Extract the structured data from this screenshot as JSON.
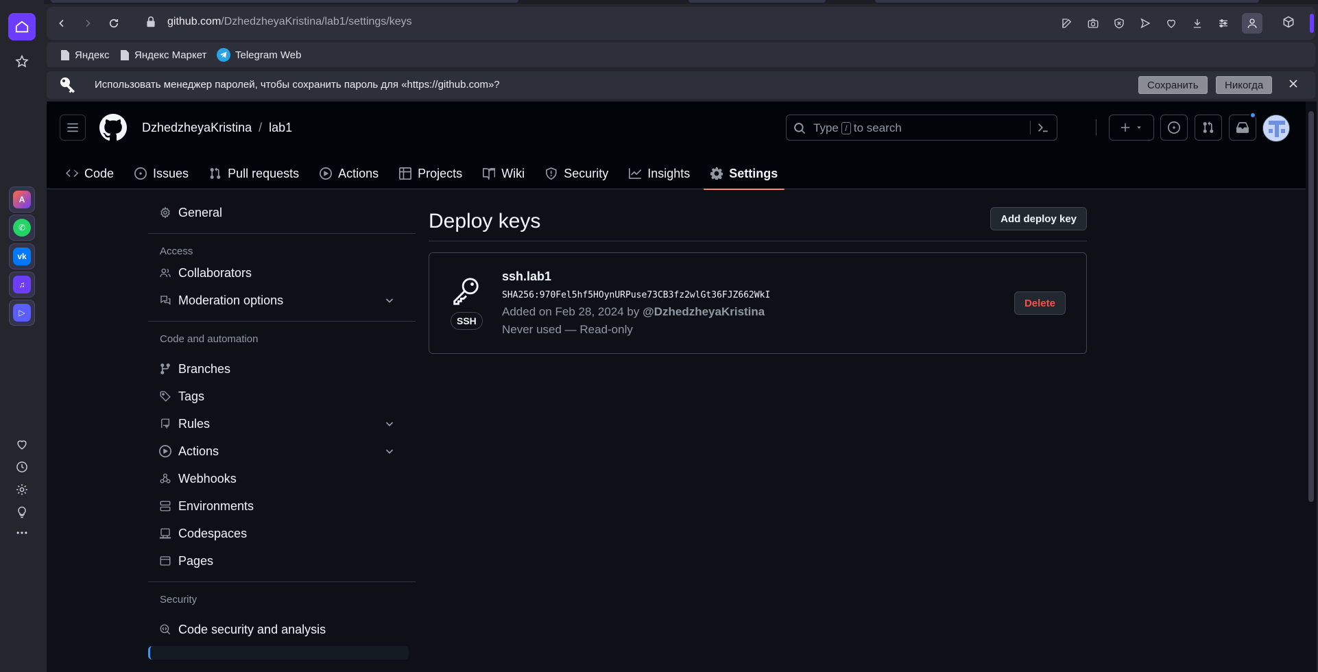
{
  "browser": {
    "url_host": "github.com",
    "url_path": "/DzhedzheyaKristina/lab1/settings/keys",
    "bookmarks": [
      {
        "label": "Яндекс",
        "icon": "page-icon"
      },
      {
        "label": "Яндекс Маркет",
        "icon": "page-icon"
      },
      {
        "label": "Telegram Web",
        "icon": "telegram-icon"
      }
    ],
    "password_prompt": {
      "message": "Использовать менеджер паролей, чтобы сохранить пароль для «https://github.com»?",
      "save_label": "Сохранить",
      "never_label": "Никогда"
    },
    "accent_color": "#6d3dff"
  },
  "header": {
    "owner": "DzhedzheyaKristina",
    "separator": "/",
    "repo": "lab1",
    "search_before": "Type",
    "search_key": "/",
    "search_after": "to search"
  },
  "repo_nav": [
    {
      "label": "Code",
      "icon": "code-icon"
    },
    {
      "label": "Issues",
      "icon": "issue-icon"
    },
    {
      "label": "Pull requests",
      "icon": "pull-request-icon"
    },
    {
      "label": "Actions",
      "icon": "play-icon"
    },
    {
      "label": "Projects",
      "icon": "table-icon"
    },
    {
      "label": "Wiki",
      "icon": "book-icon"
    },
    {
      "label": "Security",
      "icon": "shield-icon"
    },
    {
      "label": "Insights",
      "icon": "graph-icon"
    },
    {
      "label": "Settings",
      "icon": "gear-icon",
      "active": true
    }
  ],
  "sidebar": {
    "general": "General",
    "access_heading": "Access",
    "collaborators": "Collaborators",
    "moderation": "Moderation options",
    "code_heading": "Code and automation",
    "branches": "Branches",
    "tags": "Tags",
    "rules": "Rules",
    "actions": "Actions",
    "webhooks": "Webhooks",
    "environments": "Environments",
    "codespaces": "Codespaces",
    "pages": "Pages",
    "security_heading": "Security",
    "code_security": "Code security and analysis"
  },
  "main": {
    "title": "Deploy keys",
    "add_button": "Add deploy key",
    "key": {
      "name": "ssh.lab1",
      "fingerprint": "SHA256:970Fel5hf5HOynURPuse73CB3fz2wlGt36FJZ662WkI",
      "type_badge": "SSH",
      "added_prefix": "Added on Feb 28, 2024 by",
      "added_by": "@DzhedzheyaKristina",
      "usage": "Never used — Read-only",
      "delete_label": "Delete"
    }
  }
}
